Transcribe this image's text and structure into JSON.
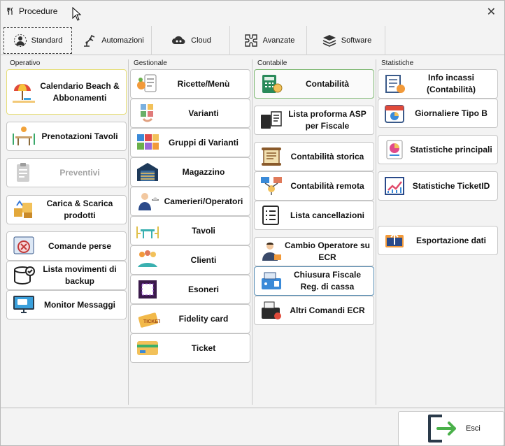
{
  "window": {
    "title": "Procedure",
    "app_icon": "fork-knife-icon"
  },
  "tabs": [
    {
      "label": "Standard",
      "icon": "gear-person-icon",
      "active": true
    },
    {
      "label": "Automazioni",
      "icon": "robot-arm-icon",
      "active": false
    },
    {
      "label": "Cloud",
      "icon": "cloud-icon",
      "active": false
    },
    {
      "label": "Avanzate",
      "icon": "puzzle-icon",
      "active": false
    },
    {
      "label": "Software",
      "icon": "layers-icon",
      "active": false
    }
  ],
  "sections": {
    "operativo": "Operativo",
    "gestionale": "Gestionale",
    "contabile": "Contabile",
    "statistiche": "Statistiche"
  },
  "operativo": [
    {
      "label": "Calendario Beach & Abbonamenti",
      "icon": "beach-umbrella-icon"
    },
    {
      "label": "Prenotazioni Tavoli",
      "icon": "table-booking-icon"
    },
    {
      "label": "Preventivi",
      "icon": "clipboard-icon",
      "disabled": true
    },
    {
      "label": "Carica & Scarica prodotti",
      "icon": "boxes-icon"
    },
    {
      "label": "Comande perse",
      "icon": "lost-order-icon"
    },
    {
      "label": "Lista movimenti di backup",
      "icon": "backup-icon"
    },
    {
      "label": "Monitor Messaggi",
      "icon": "monitor-icon"
    }
  ],
  "gestionale": [
    {
      "label": "Ricette/Menù",
      "icon": "recipe-icon"
    },
    {
      "label": "Varianti",
      "icon": "variants-icon"
    },
    {
      "label": "Gruppi di Varianti",
      "icon": "variant-groups-icon"
    },
    {
      "label": "Magazzino",
      "icon": "warehouse-icon"
    },
    {
      "label": "Camerieri/Operatori",
      "icon": "waiter-icon"
    },
    {
      "label": "Tavoli",
      "icon": "tables-icon"
    },
    {
      "label": "Clienti",
      "icon": "clients-icon"
    },
    {
      "label": "Esoneri",
      "icon": "exemption-icon"
    },
    {
      "label": "Fidelity card",
      "icon": "ticket-icon"
    },
    {
      "label": "Ticket",
      "icon": "card-icon"
    }
  ],
  "contabile": [
    {
      "label": "Contabilità",
      "icon": "calculator-icon"
    },
    {
      "label": "Lista proforma ASP per Fiscale",
      "icon": "proforma-icon"
    },
    {
      "label": "Contabilità storica",
      "icon": "scroll-icon"
    },
    {
      "label": "Contabilità remota",
      "icon": "remote-icon"
    },
    {
      "label": "Lista cancellazioni",
      "icon": "list-icon"
    },
    {
      "label": "Cambio Operatore su ECR",
      "icon": "operator-icon"
    },
    {
      "label": "Chiusura Fiscale Reg. di cassa",
      "icon": "register-icon"
    },
    {
      "label": "Altri Comandi ECR",
      "icon": "ecr-icon"
    }
  ],
  "statistiche": [
    {
      "label": "Info incassi (Contabilità)",
      "icon": "income-icon"
    },
    {
      "label": "Giornaliere Tipo B",
      "icon": "calendar-chart-icon"
    },
    {
      "label": "Statistiche principali",
      "icon": "pie-chart-icon"
    },
    {
      "label": "Statistiche TicketID",
      "icon": "trend-chart-icon"
    },
    {
      "label": "Esportazione dati",
      "icon": "export-icon"
    }
  ],
  "footer": {
    "exit_label": "Esci",
    "exit_icon": "exit-door-icon"
  }
}
